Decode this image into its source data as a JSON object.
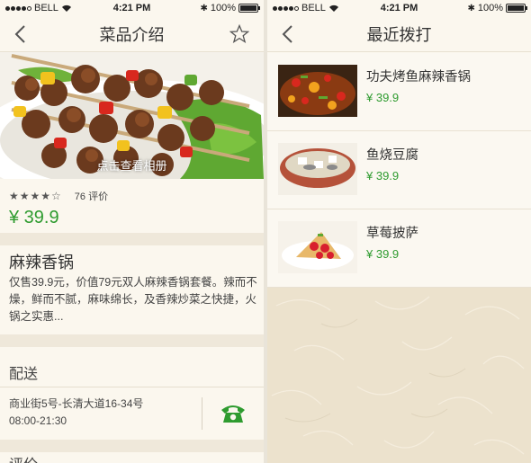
{
  "status": {
    "carrier": "BELL",
    "time": "4:21 PM",
    "battery": "100%"
  },
  "detail": {
    "nav_title": "菜品介绍",
    "photo_caption": "点击查看相册",
    "rating": {
      "stars": 4,
      "count_label": "76 评价"
    },
    "price": "¥ 39.9",
    "dish_name": "麻辣香锅",
    "description": "仅售39.9元，价值79元双人麻辣香锅套餐。辣而不燥，鲜而不腻，麻味绵长，及香辣炒菜之快捷，火锅之实惠...",
    "delivery_title": "配送",
    "address": "商业街5号-长清大道16-34号",
    "hours": "08:00-21:30",
    "reviews_title": "评价"
  },
  "recent": {
    "nav_title": "最近拨打",
    "items": [
      {
        "name": "功夫烤鱼麻辣香锅",
        "price": "¥ 39.9"
      },
      {
        "name": "鱼烧豆腐",
        "price": "¥ 39.9"
      },
      {
        "name": "草莓披萨",
        "price": "¥ 39.9"
      }
    ]
  },
  "colors": {
    "price_green": "#2e9b2f",
    "background": "#fbf7ee",
    "paper": "#ece2cd"
  },
  "icons": [
    "back-icon",
    "star-icon",
    "phone-icon",
    "wifi-icon",
    "battery-icon"
  ]
}
